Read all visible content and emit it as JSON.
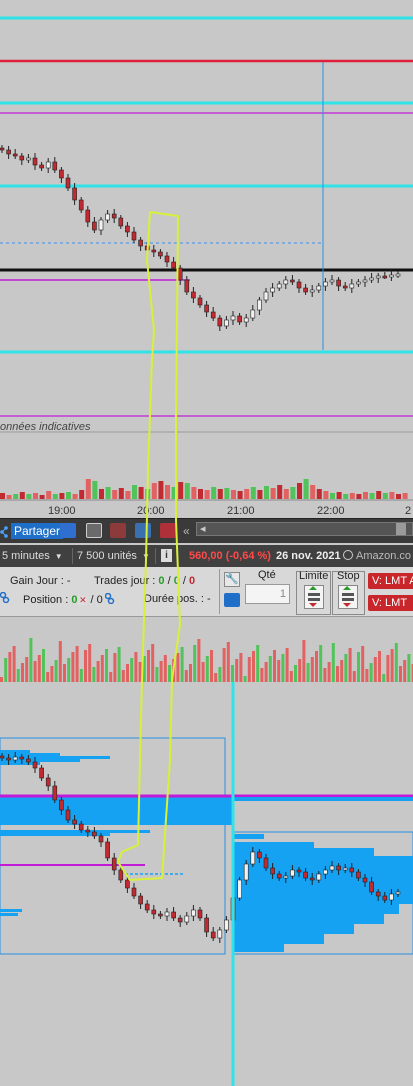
{
  "colors": {
    "accent_cyan": "#2fe3e8",
    "bearish": "#c02a30",
    "bullish": "#f2f2f2",
    "volume_up": "#52c35a",
    "volume_down": "#e26262",
    "profile_blue": "#16a2f3",
    "magenta": "#c21bd8",
    "annotation": "#d8f03a"
  },
  "chart_top": {
    "watermark": "onnées indicatives",
    "time_axis": [
      "19:00",
      "20:00",
      "21:00",
      "22:00",
      "2"
    ]
  },
  "toolbar": {
    "share_label": "Partager",
    "share_icon": "share-icon",
    "collapse_glyph": "«",
    "scroll_left_glyph": "◂"
  },
  "info_bar": {
    "interval": "5 minutes",
    "units": "7 500 unités",
    "info_glyph": "i",
    "price_change": "560,00 (-0,64 %)",
    "date": "26 nov. 2021",
    "instrument": "Amazon.co"
  },
  "order_panel": {
    "gain_label": "Gain Jour :",
    "gain_value": "-",
    "trades_label": "Trades jour :",
    "trades_a": "0",
    "trades_sep1": " / ",
    "trades_b": "0",
    "trades_sep2": " / ",
    "trades_c": "0",
    "position_label": "Position :",
    "position_value": "0",
    "position_sep": " / ",
    "position_value2": "0",
    "duration_label": "Durée pos. :",
    "duration_value": "-",
    "qty_label": "Qté",
    "qty_value": "1",
    "limit_label": "Limite",
    "stop_label": "Stop",
    "lmt_a": "V: LMT A",
    "lmt_b": "V: LMT"
  }
}
